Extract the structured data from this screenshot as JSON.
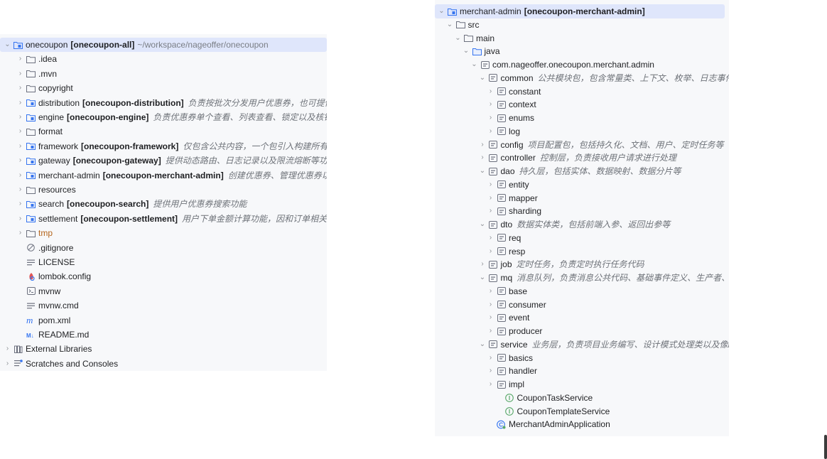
{
  "left_tree": {
    "items": [
      {
        "chev": "⌄",
        "icon": "module-folder",
        "name": "onecoupon",
        "module": "[onecoupon-all]",
        "path": "~/workspace/nageoffer/onecoupon",
        "depth": 0,
        "selected": true
      },
      {
        "chev": "›",
        "icon": "folder",
        "name": ".idea",
        "depth": 1
      },
      {
        "chev": "›",
        "icon": "folder",
        "name": ".mvn",
        "depth": 1
      },
      {
        "chev": "›",
        "icon": "folder",
        "name": "copyright",
        "depth": 1
      },
      {
        "chev": "›",
        "icon": "module-folder",
        "name": "distribution",
        "module": "[onecoupon-distribution]",
        "comment": "负责按批次分发用户优惠券，也可提供消息通知能力等",
        "depth": 1
      },
      {
        "chev": "›",
        "icon": "module-folder",
        "name": "engine",
        "module": "[onecoupon-engine]",
        "comment": "负责优惠券单个查看、列表查看、锁定以及核销等功能",
        "depth": 1
      },
      {
        "chev": "›",
        "icon": "folder",
        "name": "format",
        "depth": 1
      },
      {
        "chev": "›",
        "icon": "module-folder",
        "name": "framework",
        "module": "[onecoupon-framework]",
        "comment": "仅包含公共内容，一个包引入构建所有组件",
        "depth": 1
      },
      {
        "chev": "›",
        "icon": "module-folder",
        "name": "gateway",
        "module": "[onecoupon-gateway]",
        "comment": "提供动态路由、日志记录以及限流熔断等功能",
        "depth": 1
      },
      {
        "chev": "›",
        "icon": "module-folder",
        "name": "merchant-admin",
        "module": "[onecoupon-merchant-admin]",
        "comment": "创建优惠券、管理优惠券以及发放任务等",
        "depth": 1
      },
      {
        "chev": "›",
        "icon": "folder",
        "name": "resources",
        "depth": 1
      },
      {
        "chev": "›",
        "icon": "module-folder",
        "name": "search",
        "module": "[onecoupon-search]",
        "comment": "提供用户优惠券搜索功能",
        "depth": 1
      },
      {
        "chev": "›",
        "icon": "module-folder",
        "name": "settlement",
        "module": "[onecoupon-settlement]",
        "comment": "用户下单金额计算功能，因和订单相关联，该服务流量较大",
        "depth": 1
      },
      {
        "chev": "›",
        "icon": "folder",
        "name": "tmp",
        "depth": 1,
        "excluded": true
      },
      {
        "chev": "",
        "icon": "gitignore",
        "name": ".gitignore",
        "depth": 1
      },
      {
        "chev": "",
        "icon": "text-file",
        "name": "LICENSE",
        "depth": 1
      },
      {
        "chev": "",
        "icon": "lombok-config",
        "name": "lombok.config",
        "depth": 1
      },
      {
        "chev": "",
        "icon": "terminal-file",
        "name": "mvnw",
        "depth": 1
      },
      {
        "chev": "",
        "icon": "text-file",
        "name": "mvnw.cmd",
        "depth": 1
      },
      {
        "chev": "",
        "icon": "maven-pom",
        "name": "pom.xml",
        "depth": 1
      },
      {
        "chev": "",
        "icon": "markdown-file",
        "name": "README.md",
        "depth": 1
      },
      {
        "chev": "›",
        "icon": "library",
        "name": "External Libraries",
        "depth": 0
      },
      {
        "chev": "›",
        "icon": "scratches",
        "name": "Scratches and Consoles",
        "depth": 0
      }
    ]
  },
  "right_tree": {
    "items": [
      {
        "chev": "⌄",
        "icon": "module-folder",
        "name": "merchant-admin",
        "module": "[onecoupon-merchant-admin]",
        "depth": 0,
        "selected": true
      },
      {
        "chev": "⌄",
        "icon": "folder",
        "name": "src",
        "depth": 1
      },
      {
        "chev": "⌄",
        "icon": "folder",
        "name": "main",
        "depth": 2
      },
      {
        "chev": "⌄",
        "icon": "source-folder",
        "name": "java",
        "depth": 3
      },
      {
        "chev": "⌄",
        "icon": "package",
        "name": "com.nageoffer.onecoupon.merchant.admin",
        "depth": 4
      },
      {
        "chev": "⌄",
        "icon": "package",
        "name": "common",
        "comment": "公共模块包，包含常量类、上下文、枚举、日志事件等",
        "depth": 5
      },
      {
        "chev": "›",
        "icon": "package",
        "name": "constant",
        "depth": 6
      },
      {
        "chev": "›",
        "icon": "package",
        "name": "context",
        "depth": 6
      },
      {
        "chev": "›",
        "icon": "package",
        "name": "enums",
        "depth": 6
      },
      {
        "chev": "›",
        "icon": "package",
        "name": "log",
        "depth": 6
      },
      {
        "chev": "›",
        "icon": "package",
        "name": "config",
        "comment": "项目配置包，包括持久化、文档、用户、定时任务等",
        "depth": 5
      },
      {
        "chev": "›",
        "icon": "package",
        "name": "controller",
        "comment": "控制层，负责接收用户请求进行处理",
        "depth": 5
      },
      {
        "chev": "⌄",
        "icon": "package",
        "name": "dao",
        "comment": "持久层，包括实体、数据映射、数据分片等",
        "depth": 5
      },
      {
        "chev": "›",
        "icon": "package",
        "name": "entity",
        "depth": 6
      },
      {
        "chev": "›",
        "icon": "package",
        "name": "mapper",
        "depth": 6
      },
      {
        "chev": "›",
        "icon": "package",
        "name": "sharding",
        "depth": 6
      },
      {
        "chev": "⌄",
        "icon": "package",
        "name": "dto",
        "comment": "数据实体类，包括前端入参、返回出参等",
        "depth": 5
      },
      {
        "chev": "›",
        "icon": "package",
        "name": "req",
        "depth": 6
      },
      {
        "chev": "›",
        "icon": "package",
        "name": "resp",
        "depth": 6
      },
      {
        "chev": "›",
        "icon": "package",
        "name": "job",
        "comment": "定时任务，负责定时执行任务代码",
        "depth": 5
      },
      {
        "chev": "⌄",
        "icon": "package",
        "name": "mq",
        "comment": "消息队列，负责消息公共代码、基础事件定义、生产者、消费者等",
        "depth": 5
      },
      {
        "chev": "›",
        "icon": "package",
        "name": "base",
        "depth": 6
      },
      {
        "chev": "›",
        "icon": "package",
        "name": "consumer",
        "depth": 6
      },
      {
        "chev": "›",
        "icon": "package",
        "name": "event",
        "depth": 6
      },
      {
        "chev": "›",
        "icon": "package",
        "name": "producer",
        "depth": 6
      },
      {
        "chev": "⌄",
        "icon": "package",
        "name": "service",
        "comment": "业务层，负责项目业务编写、设计模式处理类以及像Excel处理等逻辑",
        "depth": 5
      },
      {
        "chev": "›",
        "icon": "package",
        "name": "basics",
        "depth": 6
      },
      {
        "chev": "›",
        "icon": "package",
        "name": "handler",
        "depth": 6
      },
      {
        "chev": "›",
        "icon": "package",
        "name": "impl",
        "depth": 6
      },
      {
        "chev": "",
        "icon": "interface",
        "name": "CouponTaskService",
        "depth": 7
      },
      {
        "chev": "",
        "icon": "interface",
        "name": "CouponTemplateService",
        "depth": 7
      },
      {
        "chev": "",
        "icon": "spring-class",
        "name": "MerchantAdminApplication",
        "depth": 6
      }
    ]
  },
  "colors": {
    "panel_bg": "#f7f8fa",
    "selection": "#dfe6fb",
    "comment": "#6f737a",
    "excluded": "#b5651d",
    "module_icon": "#3574f0",
    "interface_icon": "#59a869",
    "spring_icon": "#3574f0"
  }
}
